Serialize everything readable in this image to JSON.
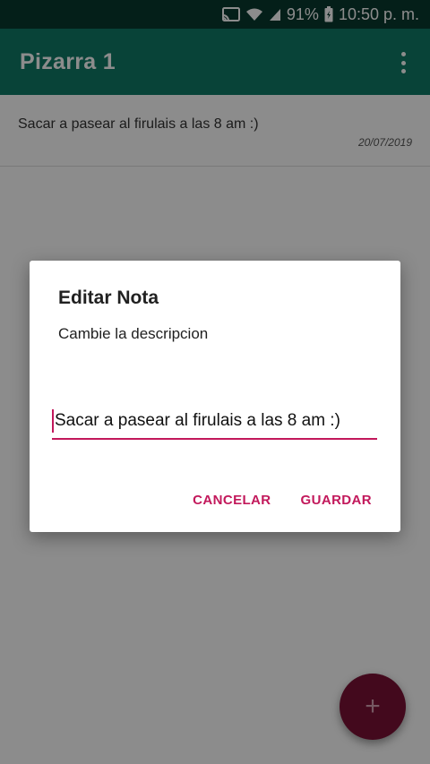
{
  "status_bar": {
    "battery": "91%",
    "time": "10:50 p. m.",
    "icons": [
      "cast-icon",
      "wifi-icon",
      "signal-icon",
      "battery-icon"
    ]
  },
  "app_bar": {
    "title": "Pizarra 1",
    "menu_icon": "overflow-menu-icon"
  },
  "notes": [
    {
      "text": "Sacar a pasear al firulais a las 8 am :)",
      "date": "20/07/2019"
    }
  ],
  "dialog": {
    "title": "Editar Nota",
    "message": "Cambie la descripcion",
    "input_value": "Sacar a pasear al firulais a las 8 am :)",
    "cancel_label": "CANCELAR",
    "save_label": "GUARDAR"
  },
  "fab": {
    "icon": "add-icon",
    "symbol": "+"
  },
  "colors": {
    "status_bar": "#08392f",
    "app_bar": "#0f7b66",
    "accent": "#c2185b",
    "fab": "#7a1236"
  }
}
